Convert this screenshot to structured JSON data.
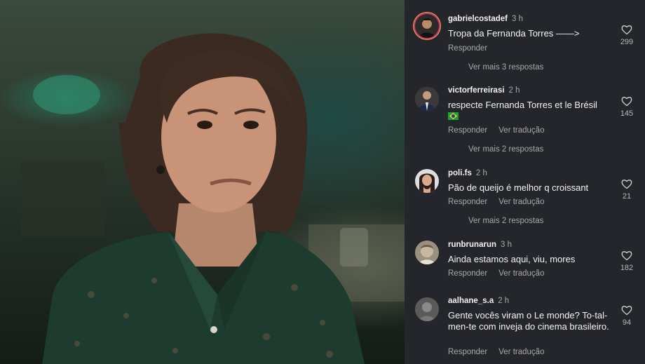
{
  "photo": {
    "alt": "photo"
  },
  "comments": [
    {
      "username": "gabrielcostadef",
      "time": "3 h",
      "text": "Tropa da Fernanda Torres ——>",
      "reply_label": "Responder",
      "likes": "299",
      "more_replies": "Ver mais 3 respostas",
      "avatar_icon": "user-avatar-icon"
    },
    {
      "username": "victorferreirasi",
      "time": "2 h",
      "text": "respecte Fernanda Torres et le Brésil",
      "flag": "brazil-flag-icon",
      "reply_label": "Responder",
      "translate_label": "Ver tradução",
      "likes": "145",
      "more_replies": "Ver mais 2 respostas",
      "avatar_icon": "user-avatar-icon"
    },
    {
      "username": "poli.fs",
      "time": "2 h",
      "text": "Pão de queijo é melhor q croissant",
      "reply_label": "Responder",
      "translate_label": "Ver tradução",
      "likes": "21",
      "more_replies": "Ver mais 2 respostas",
      "avatar_icon": "user-avatar-icon"
    },
    {
      "username": "runbrunarun",
      "time": "3 h",
      "text": "Ainda estamos aqui, viu, mores",
      "reply_label": "Responder",
      "translate_label": "Ver tradução",
      "likes": "182",
      "avatar_icon": "user-avatar-icon"
    },
    {
      "username": "aalhane_s.a",
      "time": "2 h",
      "text": "Gente vocês viram o Le monde? To-tal-men-te com inveja do cinema brasileiro.",
      "reply_label": "Responder",
      "translate_label": "Ver tradução",
      "likes": "94",
      "avatar_icon": "user-avatar-icon"
    }
  ],
  "colors": {
    "panel_bg": "#24262b",
    "muted_text": "#a8a8a8",
    "story_ring": "#c13584"
  }
}
